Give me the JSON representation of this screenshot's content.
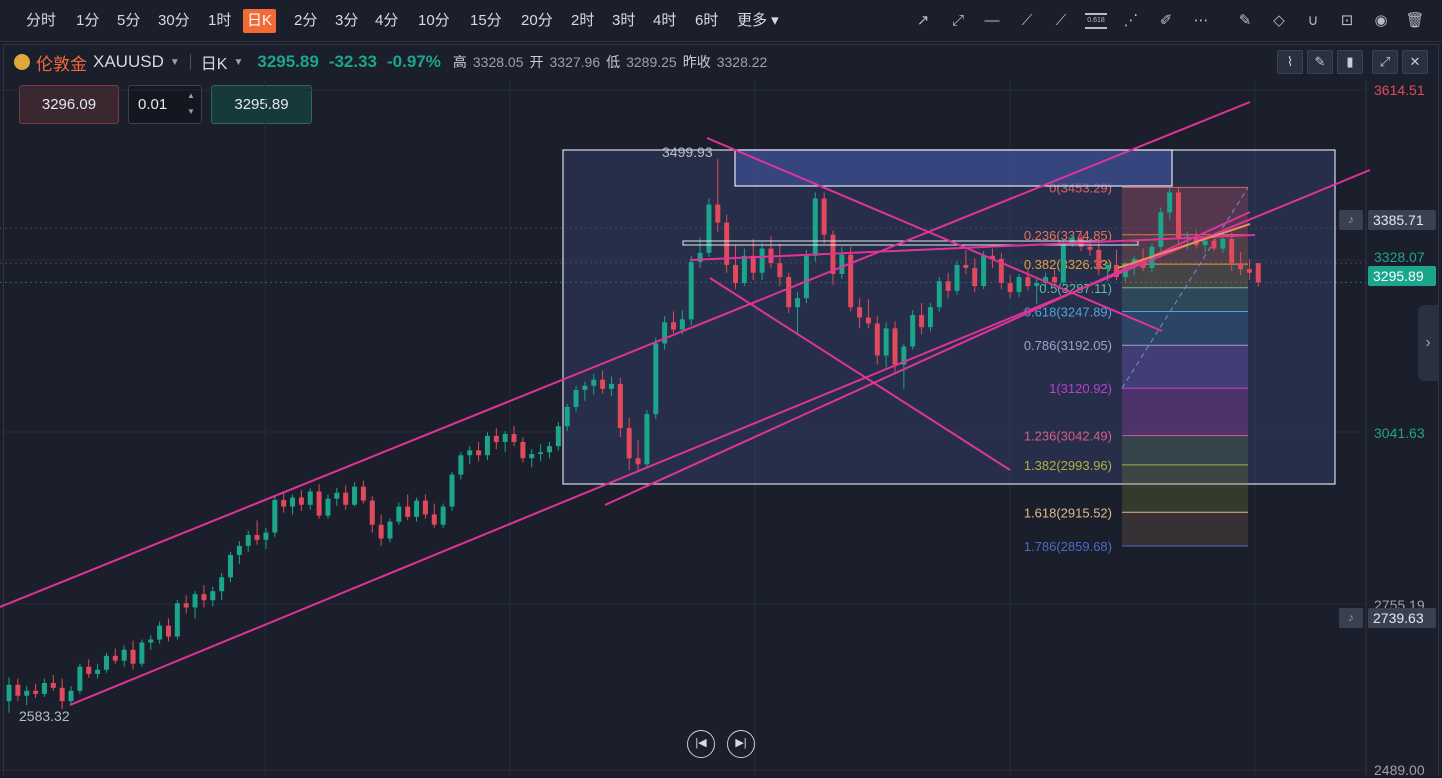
{
  "toolbar": {
    "periods": [
      "分时",
      "1分",
      "5分",
      "30分",
      "1时",
      "日K",
      "2分",
      "3分",
      "4分",
      "10分",
      "15分",
      "20分",
      "2时",
      "3时",
      "4时",
      "6时",
      "更多"
    ],
    "active_period": "日K",
    "draw_tools": [
      "arrow-line-icon",
      "dashed-line-icon",
      "horizontal-line-icon",
      "polyline-icon",
      "brush-icon",
      "fibonacci-icon",
      "fan-icon",
      "highlighter-icon",
      "more-icon"
    ],
    "edit_tools": [
      "edit-icon",
      "eraser-icon",
      "magnet-icon",
      "lock-icon",
      "eye-icon",
      "trash-icon"
    ],
    "fib_tool_label": "0.618"
  },
  "symbol": {
    "name": "伦敦金",
    "code": "XAUUSD",
    "period": "日K",
    "last": "3295.89",
    "change": "-32.33",
    "change_pct": "-0.97%",
    "high_label": "高",
    "high": "3328.05",
    "open_label": "开",
    "open": "3327.96",
    "low_label": "低",
    "low": "3289.25",
    "prev_close_label": "昨收",
    "prev_close": "3328.22"
  },
  "trade": {
    "sell_price": "3296.09",
    "lot": "0.01",
    "buy_price": "3295.89"
  },
  "chart_data": {
    "type": "candlestick",
    "price_axis_labels": [
      "3614.51",
      "3328.07",
      "3041.63",
      "2755.19",
      "2489.00"
    ],
    "price_tags": [
      {
        "value": "3385.71",
        "style": "alert",
        "color": "#3a4050"
      },
      {
        "value": "3295.89",
        "style": "current",
        "color": "#1ba58a"
      },
      {
        "value": "2739.63",
        "style": "alert",
        "color": "#3a4050"
      }
    ],
    "annotations": {
      "range_high": "3499.93",
      "range_low": "2583.32"
    },
    "fibonacci_levels": [
      {
        "ratio": "0",
        "price": "3453.29",
        "label": "0(3453.29)",
        "color": "#e0606a"
      },
      {
        "ratio": "0.236",
        "price": "3374.85",
        "label": "0.236(3374.85)",
        "color": "#e2745a"
      },
      {
        "ratio": "0.382",
        "price": "3326.33",
        "label": "0.382(3326.33)",
        "color": "#d9a441"
      },
      {
        "ratio": "0.5",
        "price": "3287.11",
        "label": "0.5(3287.11)",
        "color": "#5fbf9a"
      },
      {
        "ratio": "0.618",
        "price": "3247.89",
        "label": "0.618(3247.89)",
        "color": "#4aa8d8"
      },
      {
        "ratio": "0.786",
        "price": "3192.05",
        "label": "0.786(3192.05)",
        "color": "#9aa4c8"
      },
      {
        "ratio": "1",
        "price": "3120.92",
        "label": "1(3120.92)",
        "color": "#b840d0"
      },
      {
        "ratio": "1.236",
        "price": "3042.49",
        "label": "1.236(3042.49)",
        "color": "#d85a8a"
      },
      {
        "ratio": "1.382",
        "price": "2993.96",
        "label": "1.382(2993.96)",
        "color": "#b0b040"
      },
      {
        "ratio": "1.618",
        "price": "2915.52",
        "label": "1.618(2915.52)",
        "color": "#e0b890"
      },
      {
        "ratio": "1.786",
        "price": "2859.68",
        "label": "1.786(2859.68)",
        "color": "#4a6ac8"
      }
    ],
    "candles": [
      [
        2603,
        2642,
        2584,
        2630
      ],
      [
        2630,
        2640,
        2603,
        2612
      ],
      [
        2612,
        2628,
        2596,
        2620
      ],
      [
        2620,
        2632,
        2608,
        2615
      ],
      [
        2615,
        2640,
        2610,
        2633
      ],
      [
        2633,
        2646,
        2620,
        2625
      ],
      [
        2625,
        2640,
        2590,
        2603
      ],
      [
        2603,
        2628,
        2596,
        2620
      ],
      [
        2620,
        2665,
        2615,
        2660
      ],
      [
        2660,
        2672,
        2642,
        2648
      ],
      [
        2648,
        2665,
        2640,
        2655
      ],
      [
        2655,
        2683,
        2650,
        2678
      ],
      [
        2678,
        2690,
        2665,
        2670
      ],
      [
        2670,
        2695,
        2660,
        2688
      ],
      [
        2688,
        2703,
        2655,
        2665
      ],
      [
        2665,
        2705,
        2660,
        2700
      ],
      [
        2700,
        2712,
        2688,
        2705
      ],
      [
        2705,
        2735,
        2698,
        2728
      ],
      [
        2728,
        2740,
        2702,
        2710
      ],
      [
        2710,
        2770,
        2705,
        2765
      ],
      [
        2765,
        2778,
        2748,
        2758
      ],
      [
        2758,
        2785,
        2740,
        2780
      ],
      [
        2780,
        2795,
        2758,
        2770
      ],
      [
        2770,
        2792,
        2760,
        2785
      ],
      [
        2785,
        2815,
        2770,
        2808
      ],
      [
        2808,
        2850,
        2800,
        2845
      ],
      [
        2845,
        2868,
        2830,
        2860
      ],
      [
        2860,
        2885,
        2850,
        2878
      ],
      [
        2878,
        2902,
        2862,
        2870
      ],
      [
        2870,
        2890,
        2855,
        2882
      ],
      [
        2882,
        2942,
        2875,
        2936
      ],
      [
        2936,
        2950,
        2915,
        2925
      ],
      [
        2925,
        2945,
        2912,
        2940
      ],
      [
        2940,
        2952,
        2918,
        2928
      ],
      [
        2928,
        2955,
        2920,
        2950
      ],
      [
        2950,
        2962,
        2905,
        2910
      ],
      [
        2910,
        2945,
        2905,
        2938
      ],
      [
        2938,
        2956,
        2926,
        2948
      ],
      [
        2948,
        2960,
        2920,
        2928
      ],
      [
        2928,
        2965,
        2925,
        2958
      ],
      [
        2958,
        2968,
        2930,
        2935
      ],
      [
        2935,
        2942,
        2882,
        2895
      ],
      [
        2895,
        2912,
        2860,
        2872
      ],
      [
        2872,
        2905,
        2866,
        2900
      ],
      [
        2900,
        2932,
        2895,
        2925
      ],
      [
        2925,
        2945,
        2903,
        2908
      ],
      [
        2908,
        2940,
        2900,
        2935
      ],
      [
        2935,
        2945,
        2905,
        2912
      ],
      [
        2912,
        2930,
        2890,
        2895
      ],
      [
        2895,
        2930,
        2890,
        2925
      ],
      [
        2925,
        2982,
        2918,
        2978
      ],
      [
        2978,
        3015,
        2970,
        3010
      ],
      [
        3010,
        3025,
        2995,
        3018
      ],
      [
        3018,
        3032,
        3000,
        3010
      ],
      [
        3010,
        3048,
        3002,
        3042
      ],
      [
        3042,
        3055,
        3020,
        3032
      ],
      [
        3032,
        3050,
        3015,
        3045
      ],
      [
        3045,
        3058,
        3025,
        3032
      ],
      [
        3032,
        3040,
        2998,
        3005
      ],
      [
        3005,
        3020,
        2990,
        3012
      ],
      [
        3012,
        3028,
        3000,
        3015
      ],
      [
        3015,
        3032,
        3005,
        3025
      ],
      [
        3025,
        3065,
        3018,
        3058
      ],
      [
        3058,
        3095,
        3050,
        3090
      ],
      [
        3090,
        3125,
        3082,
        3118
      ],
      [
        3118,
        3132,
        3100,
        3125
      ],
      [
        3125,
        3145,
        3110,
        3135
      ],
      [
        3135,
        3150,
        3112,
        3120
      ],
      [
        3120,
        3140,
        3108,
        3128
      ],
      [
        3128,
        3138,
        3040,
        3055
      ],
      [
        3055,
        3072,
        2985,
        3005
      ],
      [
        3005,
        3035,
        2985,
        2995
      ],
      [
        2995,
        3085,
        2990,
        3078
      ],
      [
        3078,
        3205,
        3070,
        3195
      ],
      [
        3195,
        3240,
        3185,
        3230
      ],
      [
        3230,
        3248,
        3212,
        3218
      ],
      [
        3218,
        3250,
        3210,
        3235
      ],
      [
        3235,
        3340,
        3225,
        3330
      ],
      [
        3330,
        3370,
        3320,
        3345
      ],
      [
        3345,
        3435,
        3338,
        3425
      ],
      [
        3425,
        3500,
        3380,
        3395
      ],
      [
        3395,
        3408,
        3312,
        3325
      ],
      [
        3325,
        3358,
        3285,
        3295
      ],
      [
        3295,
        3352,
        3290,
        3340
      ],
      [
        3340,
        3368,
        3300,
        3312
      ],
      [
        3312,
        3362,
        3300,
        3352
      ],
      [
        3352,
        3372,
        3320,
        3328
      ],
      [
        3328,
        3360,
        3290,
        3305
      ],
      [
        3305,
        3312,
        3245,
        3255
      ],
      [
        3255,
        3280,
        3210,
        3270
      ],
      [
        3270,
        3350,
        3262,
        3340
      ],
      [
        3340,
        3445,
        3330,
        3435
      ],
      [
        3435,
        3445,
        3360,
        3375
      ],
      [
        3375,
        3382,
        3292,
        3310
      ],
      [
        3310,
        3355,
        3302,
        3342
      ],
      [
        3342,
        3355,
        3248,
        3255
      ],
      [
        3255,
        3270,
        3220,
        3238
      ],
      [
        3238,
        3268,
        3220,
        3228
      ],
      [
        3228,
        3240,
        3160,
        3175
      ],
      [
        3175,
        3230,
        3155,
        3220
      ],
      [
        3220,
        3232,
        3145,
        3160
      ],
      [
        3160,
        3195,
        3120,
        3190
      ],
      [
        3190,
        3250,
        3185,
        3242
      ],
      [
        3242,
        3262,
        3210,
        3222
      ],
      [
        3222,
        3262,
        3215,
        3255
      ],
      [
        3255,
        3305,
        3248,
        3298
      ],
      [
        3298,
        3312,
        3270,
        3282
      ],
      [
        3282,
        3332,
        3275,
        3325
      ],
      [
        3325,
        3350,
        3310,
        3320
      ],
      [
        3320,
        3336,
        3280,
        3290
      ],
      [
        3290,
        3348,
        3285,
        3340
      ],
      [
        3340,
        3352,
        3320,
        3335
      ],
      [
        3335,
        3345,
        3285,
        3295
      ],
      [
        3295,
        3308,
        3270,
        3280
      ],
      [
        3280,
        3310,
        3272,
        3305
      ],
      [
        3305,
        3318,
        3283,
        3290
      ],
      [
        3290,
        3302,
        3260,
        3295
      ],
      [
        3295,
        3312,
        3288,
        3305
      ],
      [
        3305,
        3318,
        3292,
        3296
      ],
      [
        3296,
        3365,
        3290,
        3360
      ],
      [
        3360,
        3375,
        3355,
        3370
      ],
      [
        3370,
        3382,
        3348,
        3355
      ],
      [
        3355,
        3368,
        3340,
        3350
      ],
      [
        3350,
        3365,
        3308,
        3318
      ],
      [
        3318,
        3330,
        3298,
        3325
      ],
      [
        3325,
        3350,
        3300,
        3305
      ],
      [
        3305,
        3330,
        3298,
        3322
      ],
      [
        3322,
        3340,
        3308,
        3335
      ],
      [
        3335,
        3352,
        3315,
        3320
      ],
      [
        3320,
        3360,
        3312,
        3355
      ],
      [
        3355,
        3420,
        3348,
        3412
      ],
      [
        3412,
        3452,
        3400,
        3445
      ],
      [
        3445,
        3453,
        3360,
        3368
      ],
      [
        3368,
        3380,
        3350,
        3372
      ],
      [
        3372,
        3382,
        3352,
        3358
      ],
      [
        3358,
        3370,
        3345,
        3365
      ],
      [
        3365,
        3372,
        3348,
        3352
      ],
      [
        3352,
        3375,
        3345,
        3368
      ],
      [
        3368,
        3378,
        3315,
        3328
      ],
      [
        3328,
        3346,
        3308,
        3318
      ],
      [
        3318,
        3335,
        3300,
        3312
      ],
      [
        3328,
        3328,
        3289,
        3296
      ]
    ]
  }
}
